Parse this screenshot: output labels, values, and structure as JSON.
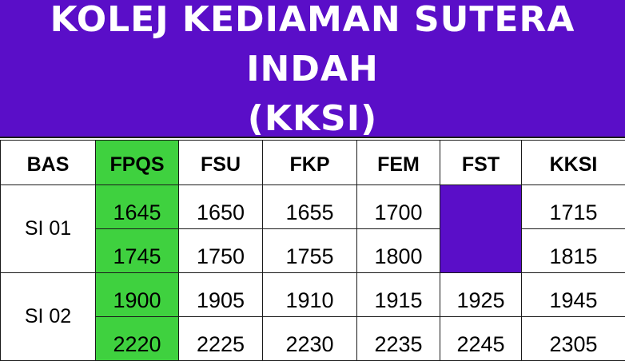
{
  "title": {
    "line1": "KOLEJ KEDIAMAN SUTERA INDAH",
    "line2": "(KKSI)"
  },
  "colors": {
    "banner": "#5a0ec8",
    "highlight": "#3fd13f"
  },
  "table": {
    "headers": [
      "BAS",
      "FPQS",
      "FSU",
      "FKP",
      "FEM",
      "FST",
      "KKSI"
    ],
    "groups": [
      {
        "bus": "SI 01",
        "rows": [
          [
            "1645",
            "1650",
            "1655",
            "1700",
            "",
            "1715"
          ],
          [
            "1745",
            "1750",
            "1755",
            "1800",
            "",
            "1815"
          ]
        ]
      },
      {
        "bus": "SI 02",
        "rows": [
          [
            "1900",
            "1905",
            "1910",
            "1915",
            "1925",
            "1945"
          ],
          [
            "2220",
            "2225",
            "2230",
            "2235",
            "2245",
            "2305"
          ]
        ]
      }
    ]
  }
}
